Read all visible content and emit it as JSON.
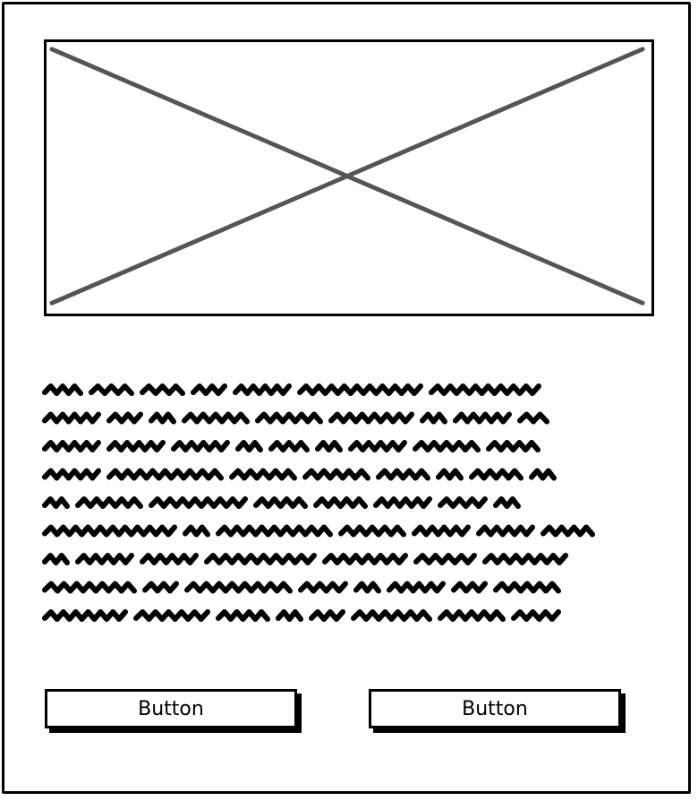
{
  "card": {
    "image": {
      "icon": "image-placeholder-icon"
    },
    "body_text": {
      "style": "scribble-placeholder",
      "line_count": 9
    },
    "buttons": [
      {
        "label": "Button"
      },
      {
        "label": "Button"
      }
    ]
  },
  "colors": {
    "stroke": "#000000",
    "cross": "#555555",
    "background": "#ffffff"
  }
}
